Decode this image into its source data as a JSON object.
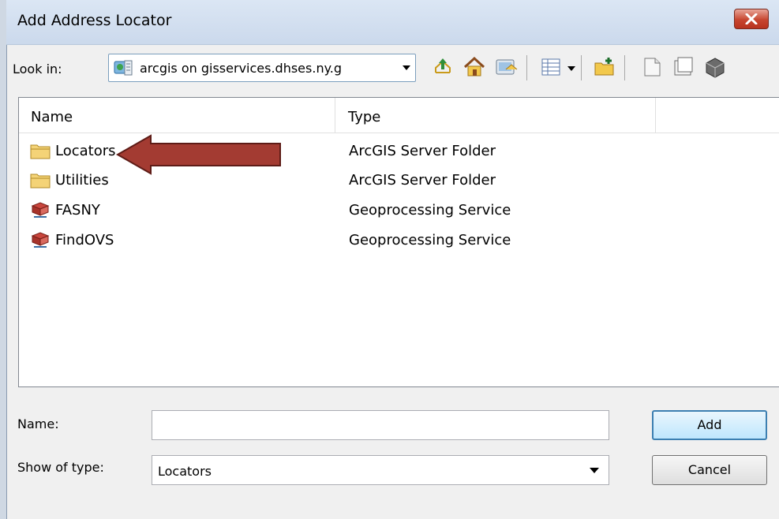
{
  "window": {
    "title": "Add Address Locator"
  },
  "lookin": {
    "label": "Look in:",
    "value": "arcgis on gisservices.dhses.ny.g"
  },
  "toolbar": {
    "icons": [
      "up-one-level-icon",
      "home-icon",
      "connect-to-folder-icon",
      "view-menu-icon",
      "new-folder-icon",
      "new-item-icon",
      "new-item-2-icon",
      "new-item-3-icon"
    ]
  },
  "filelist": {
    "columns": {
      "name": "Name",
      "type": "Type"
    },
    "rows": [
      {
        "name": "Locators",
        "type": "ArcGIS Server Folder",
        "icon": "folder-icon"
      },
      {
        "name": "Utilities",
        "type": "ArcGIS Server Folder",
        "icon": "folder-icon"
      },
      {
        "name": "FASNY",
        "type": "Geoprocessing Service",
        "icon": "geoprocessing-icon"
      },
      {
        "name": "FindOVS",
        "type": "Geoprocessing Service",
        "icon": "geoprocessing-icon"
      }
    ]
  },
  "form": {
    "name_label": "Name:",
    "name_value": "",
    "type_label": "Show of type:",
    "type_value": "Locators"
  },
  "buttons": {
    "add": "Add",
    "cancel": "Cancel"
  },
  "colors": {
    "annotation_arrow": "#a33b32",
    "close_button": "#c7452f"
  }
}
